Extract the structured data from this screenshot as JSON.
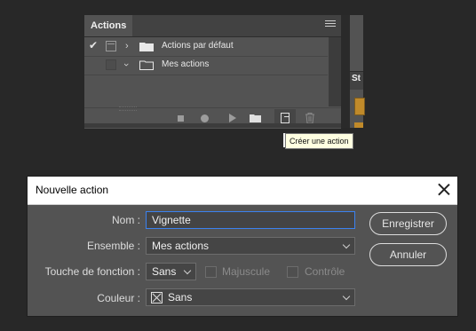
{
  "actions_panel": {
    "tab_label": "Actions",
    "menu_icon": "hamburger-icon",
    "rows": [
      {
        "label": "Actions par défaut",
        "checked": true,
        "dialog_toggle": true,
        "expanded": false
      },
      {
        "label": "Mes actions",
        "checked": false,
        "dialog_toggle": false,
        "expanded": true
      }
    ],
    "toolbar": [
      "stop-icon",
      "record-icon",
      "play-icon",
      "new-set-folder-icon",
      "new-action-icon",
      "trash-icon"
    ],
    "tooltip": "Créer une action"
  },
  "side_panel": {
    "tab_label": "St"
  },
  "dialog": {
    "title": "Nouvelle action",
    "name_label": "Nom :",
    "name_value": "Vignette",
    "set_label": "Ensemble :",
    "set_value": "Mes actions",
    "function_key_label": "Touche de fonction :",
    "function_key_value": "Sans",
    "shift_label": "Majuscule",
    "control_label": "Contrôle",
    "color_label": "Couleur :",
    "color_value": "Sans",
    "record_button": "Enregistrer",
    "cancel_button": "Annuler",
    "accent_color": "#3b82f0"
  }
}
